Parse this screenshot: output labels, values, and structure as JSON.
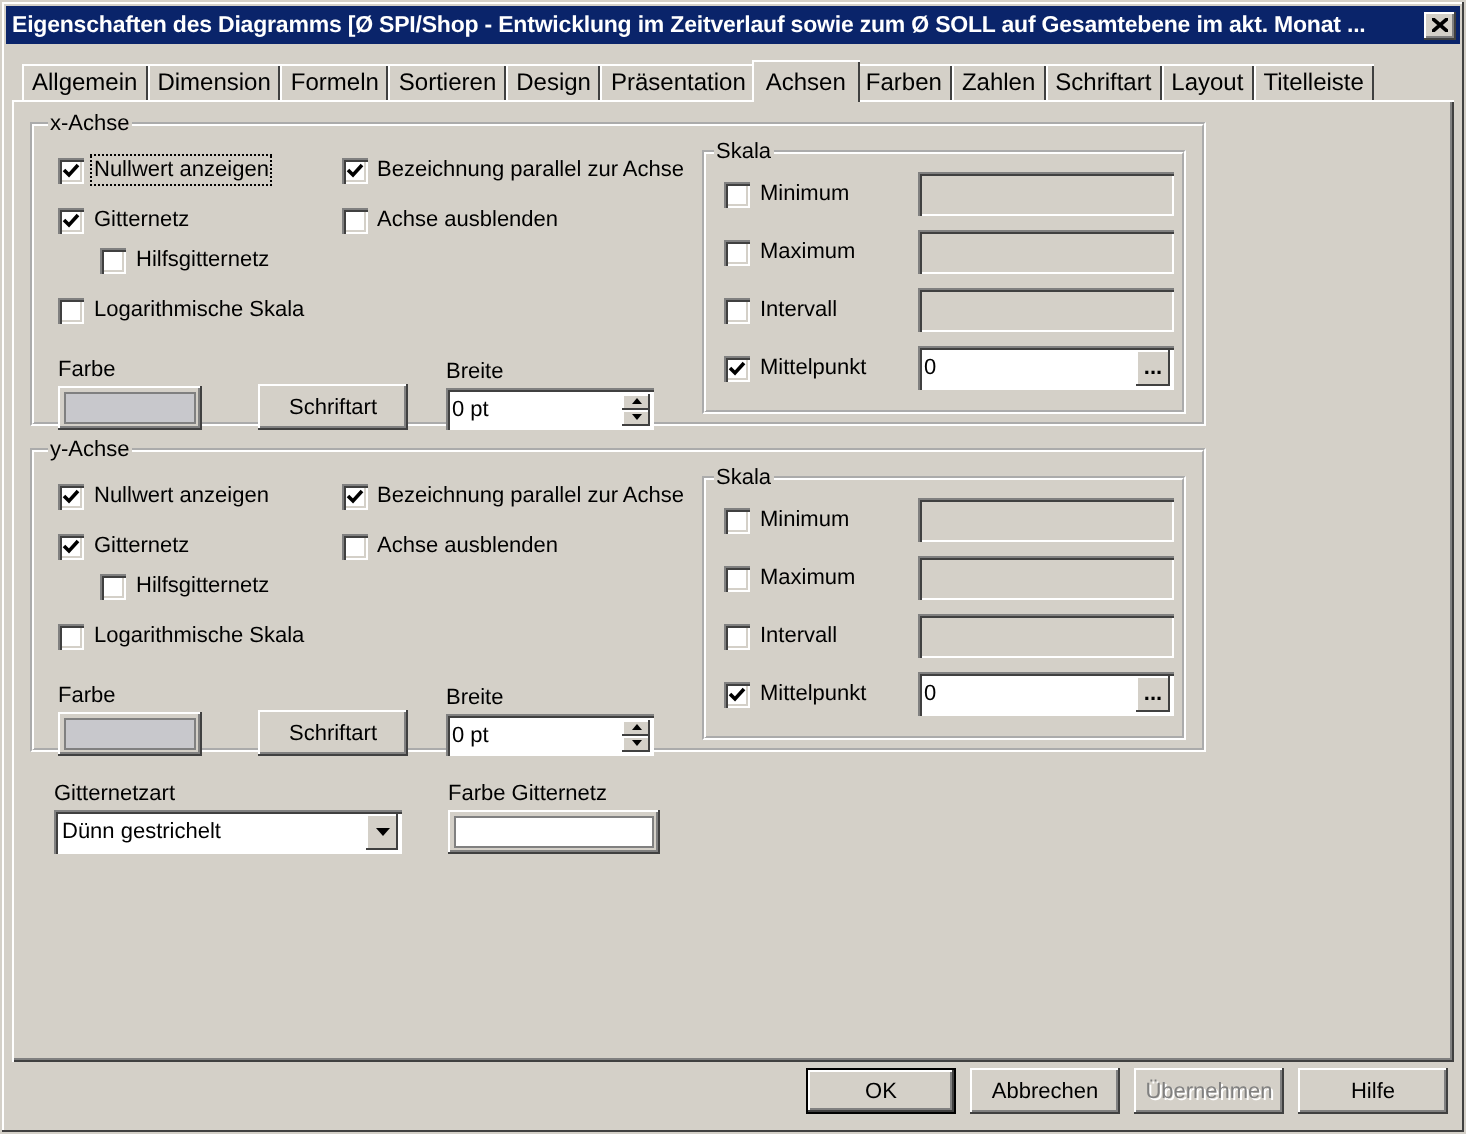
{
  "window": {
    "title": "Eigenschaften des Diagramms [Ø SPI/Shop - Entwicklung im Zeitverlauf sowie zum Ø SOLL auf Gesamtebene im akt. Monat ..."
  },
  "tabs": [
    {
      "label": "Allgemein",
      "selected": false
    },
    {
      "label": "Dimension",
      "selected": false
    },
    {
      "label": "Formeln",
      "selected": false
    },
    {
      "label": "Sortieren",
      "selected": false
    },
    {
      "label": "Design",
      "selected": false
    },
    {
      "label": "Präsentation",
      "selected": false
    },
    {
      "label": "Achsen",
      "selected": true
    },
    {
      "label": "Farben",
      "selected": false
    },
    {
      "label": "Zahlen",
      "selected": false
    },
    {
      "label": "Schriftart",
      "selected": false
    },
    {
      "label": "Layout",
      "selected": false
    },
    {
      "label": "Titelleiste",
      "selected": false
    }
  ],
  "axes": [
    {
      "title": "x-Achse",
      "left_options": [
        {
          "label": "Nullwert anzeigen",
          "checked": true,
          "focused": true
        },
        {
          "label": "Gitternetz",
          "checked": true,
          "children": [
            {
              "label": "Hilfsgitternetz",
              "checked": false
            }
          ]
        },
        {
          "label": "Logarithmische Skala",
          "checked": false
        }
      ],
      "right_options": [
        {
          "label": "Bezeichnung parallel zur Achse",
          "checked": true
        },
        {
          "label": "Achse ausblenden",
          "checked": false
        }
      ],
      "color_label": "Farbe",
      "font_button": "Schriftart",
      "width_label": "Breite",
      "width_value": "0 pt",
      "scale": {
        "title": "Skala",
        "rows": [
          {
            "label": "Minimum",
            "checked": false
          },
          {
            "label": "Maximum",
            "checked": false
          },
          {
            "label": "Intervall",
            "checked": false
          },
          {
            "label": "Mittelpunkt",
            "checked": true,
            "value": "0",
            "browse": "..."
          }
        ]
      }
    },
    {
      "title": "y-Achse",
      "left_options": [
        {
          "label": "Nullwert anzeigen",
          "checked": true,
          "focused": false
        },
        {
          "label": "Gitternetz",
          "checked": true,
          "children": [
            {
              "label": "Hilfsgitternetz",
              "checked": false
            }
          ]
        },
        {
          "label": "Logarithmische Skala",
          "checked": false
        }
      ],
      "right_options": [
        {
          "label": "Bezeichnung parallel zur Achse",
          "checked": true
        },
        {
          "label": "Achse ausblenden",
          "checked": false
        }
      ],
      "color_label": "Farbe",
      "font_button": "Schriftart",
      "width_label": "Breite",
      "width_value": "0 pt",
      "scale": {
        "title": "Skala",
        "rows": [
          {
            "label": "Minimum",
            "checked": false
          },
          {
            "label": "Maximum",
            "checked": false
          },
          {
            "label": "Intervall",
            "checked": false
          },
          {
            "label": "Mittelpunkt",
            "checked": true,
            "value": "0",
            "browse": "..."
          }
        ]
      }
    }
  ],
  "grid_type": {
    "label": "Gitternetzart",
    "value": "Dünn gestrichelt"
  },
  "grid_color": {
    "label": "Farbe Gitternetz"
  },
  "buttons": [
    {
      "label": "OK",
      "default": true,
      "disabled": false
    },
    {
      "label": "Abbrechen",
      "default": false,
      "disabled": false
    },
    {
      "label": "Übernehmen",
      "default": false,
      "disabled": true
    },
    {
      "label": "Hilfe",
      "default": false,
      "disabled": false
    }
  ]
}
